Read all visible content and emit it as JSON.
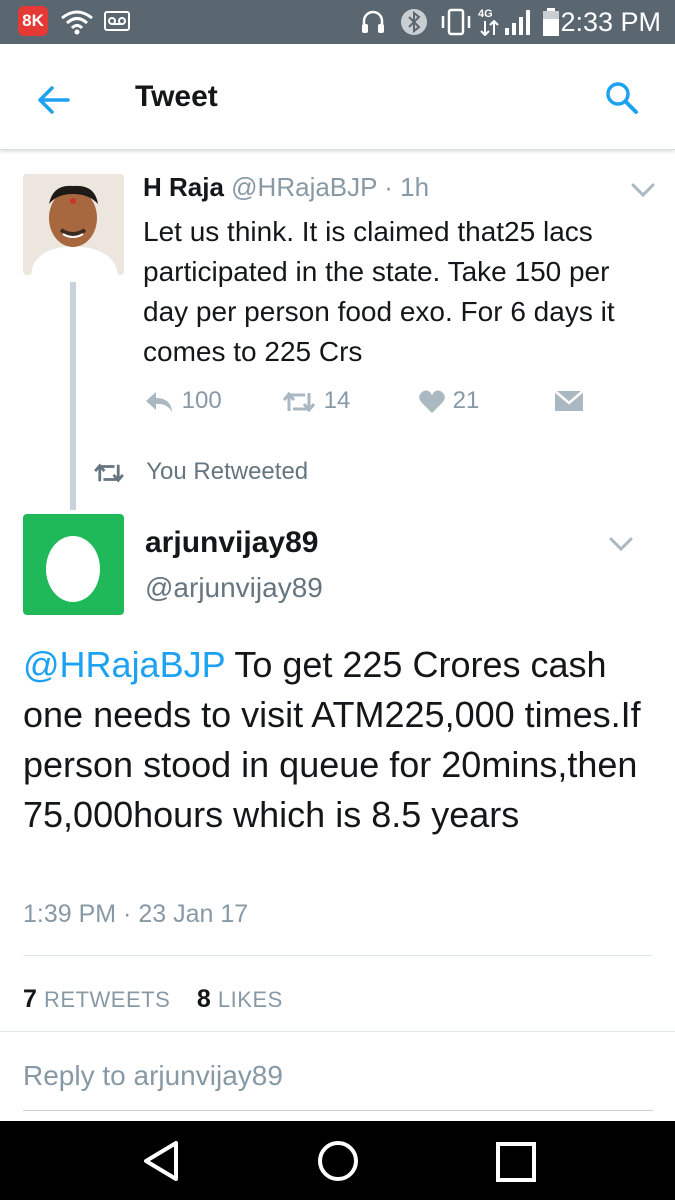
{
  "status_bar": {
    "app_badge": "8K",
    "time": "2:33 PM",
    "network": "4G"
  },
  "header": {
    "title": "Tweet"
  },
  "tweet1": {
    "name": "H Raja",
    "handle": "@HRajaBJP",
    "age": "1h",
    "text": "Let us think. It is claimed that25 lacs participated in the state. Take 150 per day per person food exo. For 6 days it comes to 225 Crs",
    "replies": "100",
    "retweets": "14",
    "likes": "21"
  },
  "retweet_context": {
    "label": "You Retweeted"
  },
  "tweet2": {
    "name": "arjunvijay89",
    "handle": "@arjunvijay89",
    "mention": "@HRajaBJP",
    "text": " To get 225 Crores cash one needs to visit ATM225,000 times.If person stood in queue for 20mins,then 75,000hours which is 8.5 years",
    "timestamp": "1:39 PM · 23 Jan 17",
    "retweets_count": "7",
    "retweets_label": "RETWEETS",
    "likes_count": "8",
    "likes_label": "LIKES"
  },
  "reply_box": {
    "placeholder": "Reply to arjunvijay89"
  },
  "colors": {
    "accent": "#1da1f2",
    "status_bar": "#5a6670",
    "egg_avatar": "#1fb95a",
    "muted": "#8899a6"
  },
  "icons": [
    "back-arrow-icon",
    "search-icon",
    "chevron-down-icon",
    "reply-icon",
    "retweet-icon",
    "heart-icon",
    "direct-message-icon",
    "back-nav-icon",
    "home-nav-icon",
    "recents-nav-icon"
  ]
}
